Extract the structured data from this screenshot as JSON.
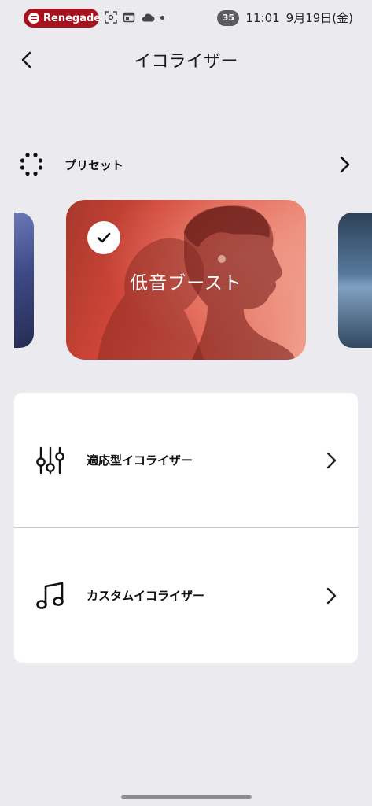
{
  "status_bar": {
    "media_app": "Renegade",
    "battery": "35",
    "time": "11:01",
    "date": "9月19日(金)"
  },
  "header": {
    "title": "イコライザー"
  },
  "preset": {
    "label": "プリセット"
  },
  "carousel": {
    "selected_label": "低音ブースト"
  },
  "options": [
    {
      "label": "適応型イコライザー",
      "icon": "equalizer-sliders-icon"
    },
    {
      "label": "カスタムイコライザー",
      "icon": "music-note-icon"
    }
  ],
  "colors": {
    "background": "#ebebef",
    "card_red": "#d4483a",
    "pill_red": "#a8121f"
  }
}
